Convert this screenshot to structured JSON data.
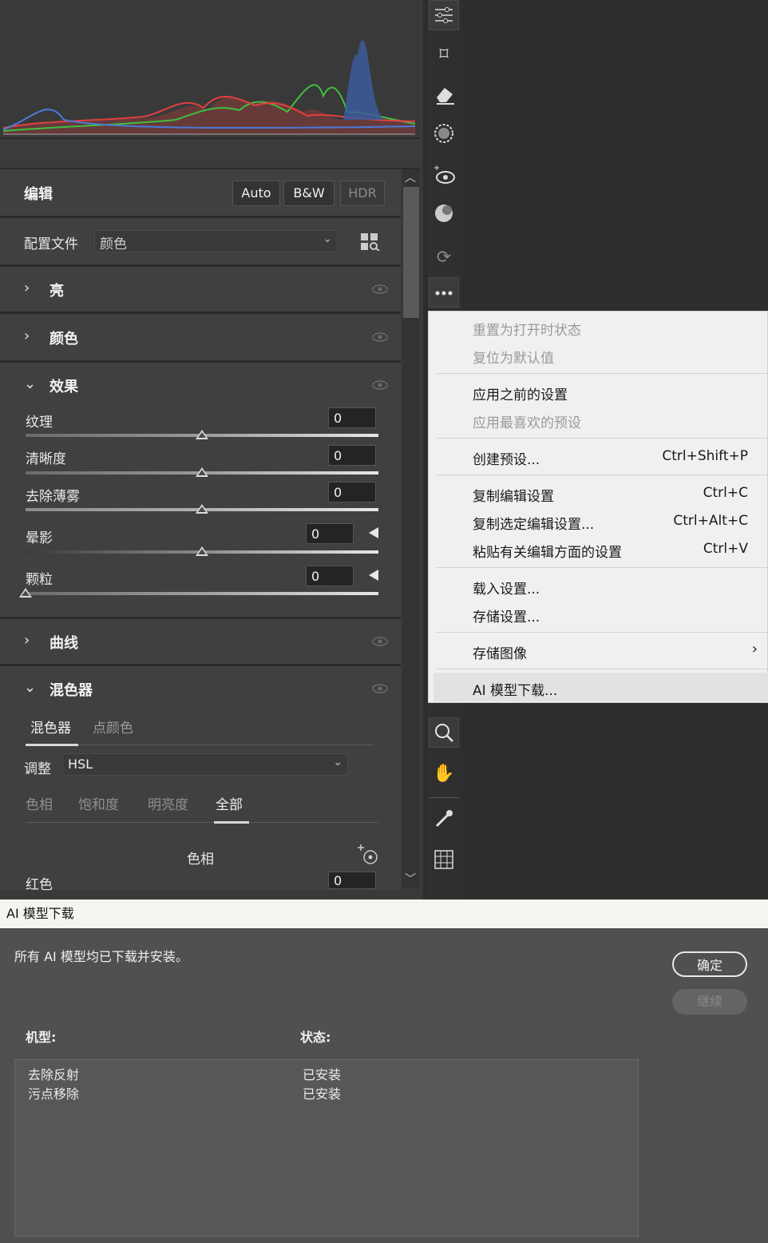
{
  "panel": {
    "edit_title": "编辑",
    "btn_auto": "Auto",
    "btn_bw": "B&W",
    "btn_hdr": "HDR",
    "profile_label": "配置文件",
    "profile_value": "颜色",
    "sections": {
      "light": "亮",
      "color": "颜色",
      "effects": "效果",
      "curves": "曲线",
      "mixer": "混色器"
    },
    "effects": {
      "texture": {
        "label": "纹理",
        "value": "0"
      },
      "clarity": {
        "label": "清晰度",
        "value": "0"
      },
      "dehaze": {
        "label": "去除薄雾",
        "value": "0"
      },
      "vignette": {
        "label": "晕影",
        "value": "0"
      },
      "grain": {
        "label": "颗粒",
        "value": "0"
      }
    },
    "mixer": {
      "tab_mixer": "混色器",
      "tab_point_color": "点颜色",
      "adjust_label": "调整",
      "adjust_value": "HSL",
      "subtabs": [
        "色相",
        "饱和度",
        "明亮度",
        "全部"
      ],
      "hue_heading": "色相",
      "red_label": "红色",
      "red_value": "0"
    }
  },
  "menu": {
    "reset_open": "重置为打开时状态",
    "reset_default": "复位为默认值",
    "apply_previous": "应用之前的设置",
    "apply_favorite": "应用最喜欢的预设",
    "create_preset": "创建预设...",
    "create_preset_sc": "Ctrl+Shift+P",
    "copy_settings": "复制编辑设置",
    "copy_settings_sc": "Ctrl+C",
    "copy_selected": "复制选定编辑设置...",
    "copy_selected_sc": "Ctrl+Alt+C",
    "paste_settings": "粘贴有关编辑方面的设置",
    "paste_settings_sc": "Ctrl+V",
    "load_settings": "载入设置...",
    "save_settings": "存储设置...",
    "save_image": "存储图像",
    "ai_download": "AI 模型下载..."
  },
  "dialog": {
    "title": "AI 模型下载",
    "message": "所有 AI 模型均已下载并安装。",
    "ok": "确定",
    "continue": "继续",
    "col_model": "机型:",
    "col_status": "状态:",
    "rows": [
      {
        "model": "去除反射",
        "status": "已安装"
      },
      {
        "model": "污点移除",
        "status": "已安装"
      }
    ]
  }
}
